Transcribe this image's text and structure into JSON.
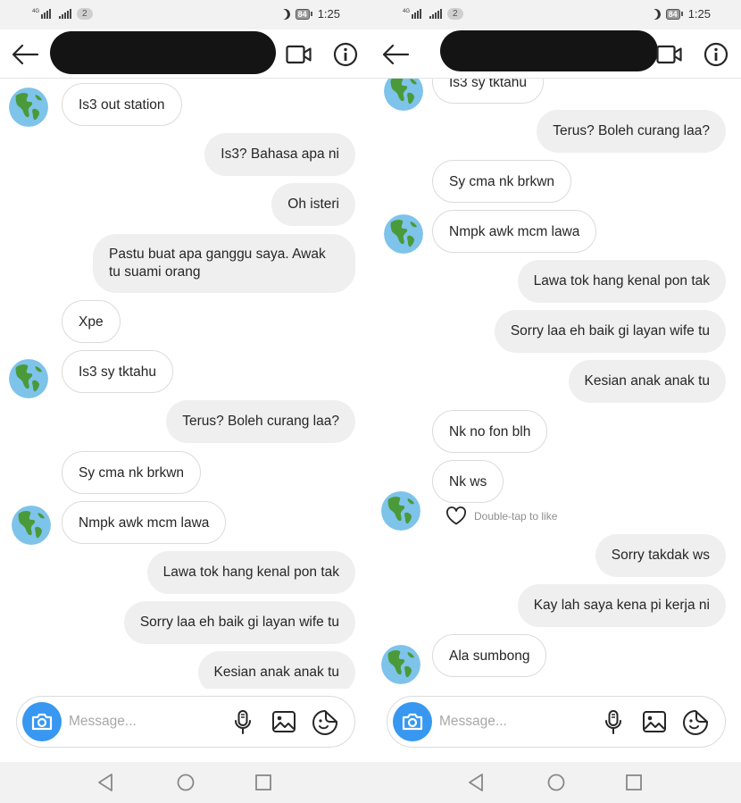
{
  "status_bar": {
    "network": "4G",
    "sim_badge": "2",
    "battery": "84",
    "time": "1:25"
  },
  "composer": {
    "placeholder": "Message..."
  },
  "left": {
    "messages": [
      {
        "side": "in",
        "text": "Is3 out station"
      },
      {
        "side": "out",
        "text": "Is3? Bahasa apa ni"
      },
      {
        "side": "out",
        "text": "Oh isteri"
      },
      {
        "side": "out",
        "text": "Pastu buat apa ganggu saya. Awak tu suami orang"
      },
      {
        "side": "in",
        "text": "Xpe"
      },
      {
        "side": "in",
        "text": "Is3 sy tktahu"
      },
      {
        "side": "out",
        "text": "Terus? Boleh curang laa?"
      },
      {
        "side": "in",
        "text": "Sy cma nk brkwn"
      },
      {
        "side": "in",
        "text": "Nmpk awk mcm lawa"
      },
      {
        "side": "out",
        "text": "Lawa tok hang kenal pon tak"
      },
      {
        "side": "out",
        "text": "Sorry laa eh baik gi layan wife tu"
      },
      {
        "side": "out",
        "text": "Kesian anak anak tu"
      }
    ]
  },
  "right": {
    "messages": [
      {
        "side": "in",
        "text": "Is3 sy tktahu"
      },
      {
        "side": "out",
        "text": "Terus? Boleh curang laa?"
      },
      {
        "side": "in",
        "text": "Sy cma nk brkwn"
      },
      {
        "side": "in",
        "text": "Nmpk awk mcm lawa"
      },
      {
        "side": "out",
        "text": "Lawa tok hang kenal pon tak"
      },
      {
        "side": "out",
        "text": "Sorry laa eh baik gi layan wife tu"
      },
      {
        "side": "out",
        "text": "Kesian anak anak tu"
      },
      {
        "side": "in",
        "text": "Nk no fon blh"
      },
      {
        "side": "in",
        "text": "Nk ws"
      },
      {
        "side": "out",
        "text": "Sorry takdak ws"
      },
      {
        "side": "out",
        "text": "Kay lah saya kena pi kerja ni"
      },
      {
        "side": "in",
        "text": "Ala sumbong"
      }
    ],
    "like_hint": "Double-tap to like"
  }
}
